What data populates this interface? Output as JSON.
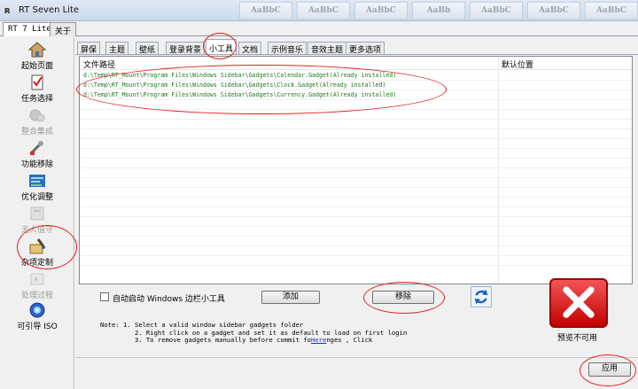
{
  "window": {
    "title": "RT Seven Lite"
  },
  "ribbon_ghost": [
    "AaBbC",
    "AaBbC",
    "AaBbC",
    "AaBb",
    "AaBbC",
    "AaBbC",
    "AaBbC"
  ],
  "top_tabs": [
    {
      "label": "RT 7 Lite",
      "active": true
    },
    {
      "label": "关于",
      "active": false
    }
  ],
  "sidebar": {
    "items": [
      {
        "label": "起始页面",
        "icon": "home-icon",
        "enabled": true
      },
      {
        "label": "任务选择",
        "icon": "task-checklist-icon",
        "enabled": true
      },
      {
        "label": "整合集成",
        "icon": "integrate-gears-icon",
        "enabled": false
      },
      {
        "label": "功能移除",
        "icon": "remove-tools-icon",
        "enabled": true
      },
      {
        "label": "优化调整",
        "icon": "tweak-bars-icon",
        "enabled": true
      },
      {
        "label": "无人值守",
        "icon": "unattended-icon",
        "enabled": false
      },
      {
        "label": "杂项定制",
        "icon": "customize-brush-icon",
        "enabled": true
      },
      {
        "label": "处理过程",
        "icon": "process-icon",
        "enabled": false
      },
      {
        "label": "可引导 ISO",
        "icon": "iso-disc-icon",
        "enabled": true
      }
    ]
  },
  "sub_tabs": [
    {
      "label": "屏保",
      "active": false
    },
    {
      "label": "主题",
      "active": false
    },
    {
      "label": "壁纸",
      "active": false
    },
    {
      "label": "登录背景",
      "active": false
    },
    {
      "label": "小工具",
      "active": true
    },
    {
      "label": "文档",
      "active": false
    },
    {
      "label": "示例音乐",
      "active": false
    },
    {
      "label": "音效主题",
      "active": false
    },
    {
      "label": "更多选项",
      "active": false
    }
  ],
  "list": {
    "columns": [
      "文件路径",
      "默认位置"
    ],
    "rows": [
      "d:\\Temp\\RT_Mount\\Program Files\\Windows Sidebar\\Gadgets\\Calendar.Gadget(Already installed)",
      "d:\\Temp\\RT_Mount\\Program Files\\Windows Sidebar\\Gadgets\\Clock.Gadget(Already installed)",
      "d:\\Temp\\RT_Mount\\Program Files\\Windows Sidebar\\Gadgets\\Currency.Gadget(Already installed)"
    ]
  },
  "controls": {
    "autostart_label": "自动启动 Windows 边栏小工具",
    "add_label": "添加",
    "remove_label": "移除",
    "no_preview_label": "预览不可用",
    "apply_label": "应用"
  },
  "notes": {
    "line1": "Note: 1. Select a valid window sidebar gadgets folder",
    "line2": "2. Right click on a gadget and set it as default to load on first login",
    "line3_pre": "3. To remove gadgets manually before commit fo",
    "line3_link": "Here",
    "line3_post": "nges , Click"
  },
  "colors": {
    "annotation": "#e02020",
    "path_text": "#1c7a1c",
    "no_preview": "#c40000"
  }
}
